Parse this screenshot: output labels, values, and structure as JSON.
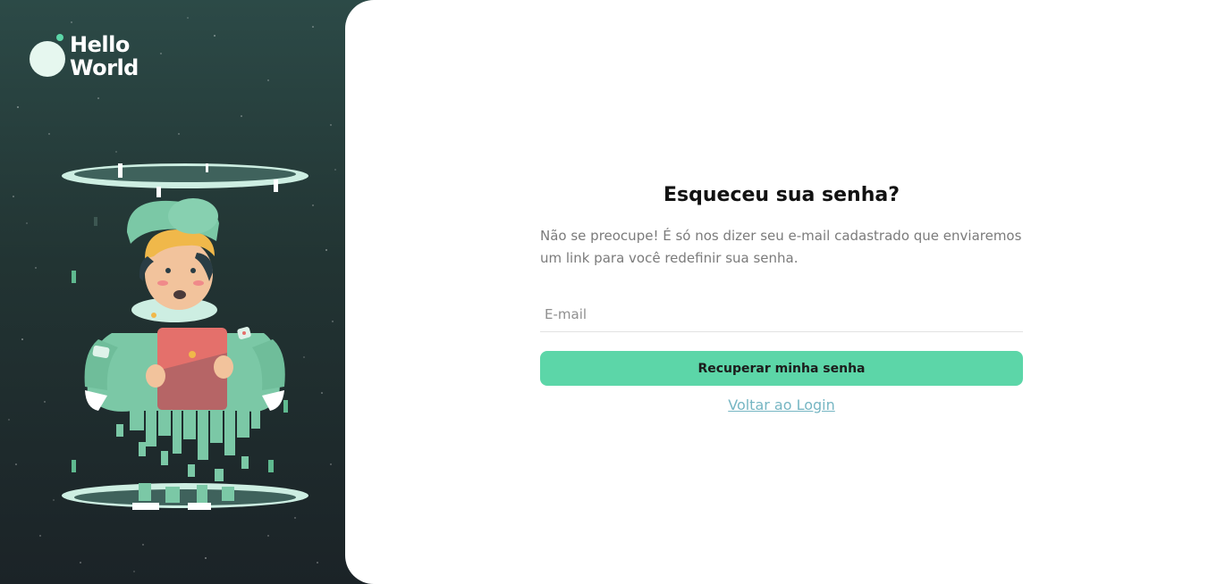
{
  "brand": {
    "line1": "Hello",
    "line2": "World",
    "accent_color": "#5cd6a8"
  },
  "illustration": {
    "icon": "teleporting-astronaut-illustration"
  },
  "form": {
    "title": "Esqueceu sua senha?",
    "subtitle": "Não se preocupe! É só nos dizer seu e-mail cadastrado que enviaremos um link para você redefinir sua senha.",
    "email_placeholder": "E-mail",
    "email_value": "",
    "submit_label": "Recuperar minha senha",
    "back_link": "Voltar ao Login"
  },
  "colors": {
    "button": "#5cd6a8",
    "link": "#76b6c3",
    "background_dark": "#1b2327"
  }
}
